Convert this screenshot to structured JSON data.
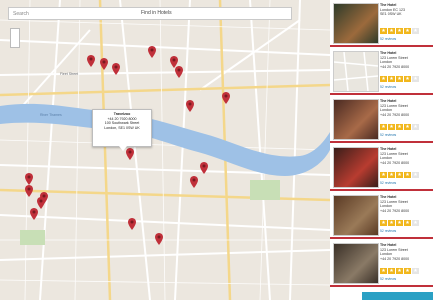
{
  "search": {
    "placeholder": "Search",
    "button": "Find in Hotels"
  },
  "popup": {
    "title": "Travelzoo",
    "lines": [
      "+44 20 7920 8000",
      "100 Southwark Street",
      "London, SE1 0SW  UK"
    ]
  },
  "map_labels": {
    "river": "River Thames",
    "street": "Fleet Street"
  },
  "colors": {
    "accent": "#c0303a",
    "star": "#f1b71c",
    "water": "#9ec1e6",
    "link": "#2a7ab0"
  },
  "icons": {
    "pin": "map-pin-icon",
    "star": "star-icon"
  },
  "cards": [
    {
      "name": "The Hotel",
      "lines": [
        "London EC 123",
        "SE1 0SW UK"
      ],
      "rating": 4,
      "reviews": "52 reviews"
    },
    {
      "name": "The Hotel",
      "lines": [
        "123 Lorem Street",
        "London",
        "+44 20 7920 8000"
      ],
      "rating": 4,
      "reviews": "52 reviews"
    },
    {
      "name": "The Hotel",
      "lines": [
        "123 Lorem Street",
        "London",
        "+44 20 7920 8000"
      ],
      "rating": 4,
      "reviews": "52 reviews"
    },
    {
      "name": "The Hotel",
      "lines": [
        "123 Lorem Street",
        "London",
        "+44 20 7920 8000"
      ],
      "rating": 4,
      "reviews": "52 reviews"
    },
    {
      "name": "The Hotel",
      "lines": [
        "123 Lorem Street",
        "London",
        "+44 20 7920 8000"
      ],
      "rating": 4,
      "reviews": "52 reviews"
    },
    {
      "name": "The Hotel",
      "lines": [
        "123 Lorem Street",
        "London",
        "+44 20 7920 8000"
      ],
      "rating": 4,
      "reviews": "52 reviews"
    }
  ]
}
